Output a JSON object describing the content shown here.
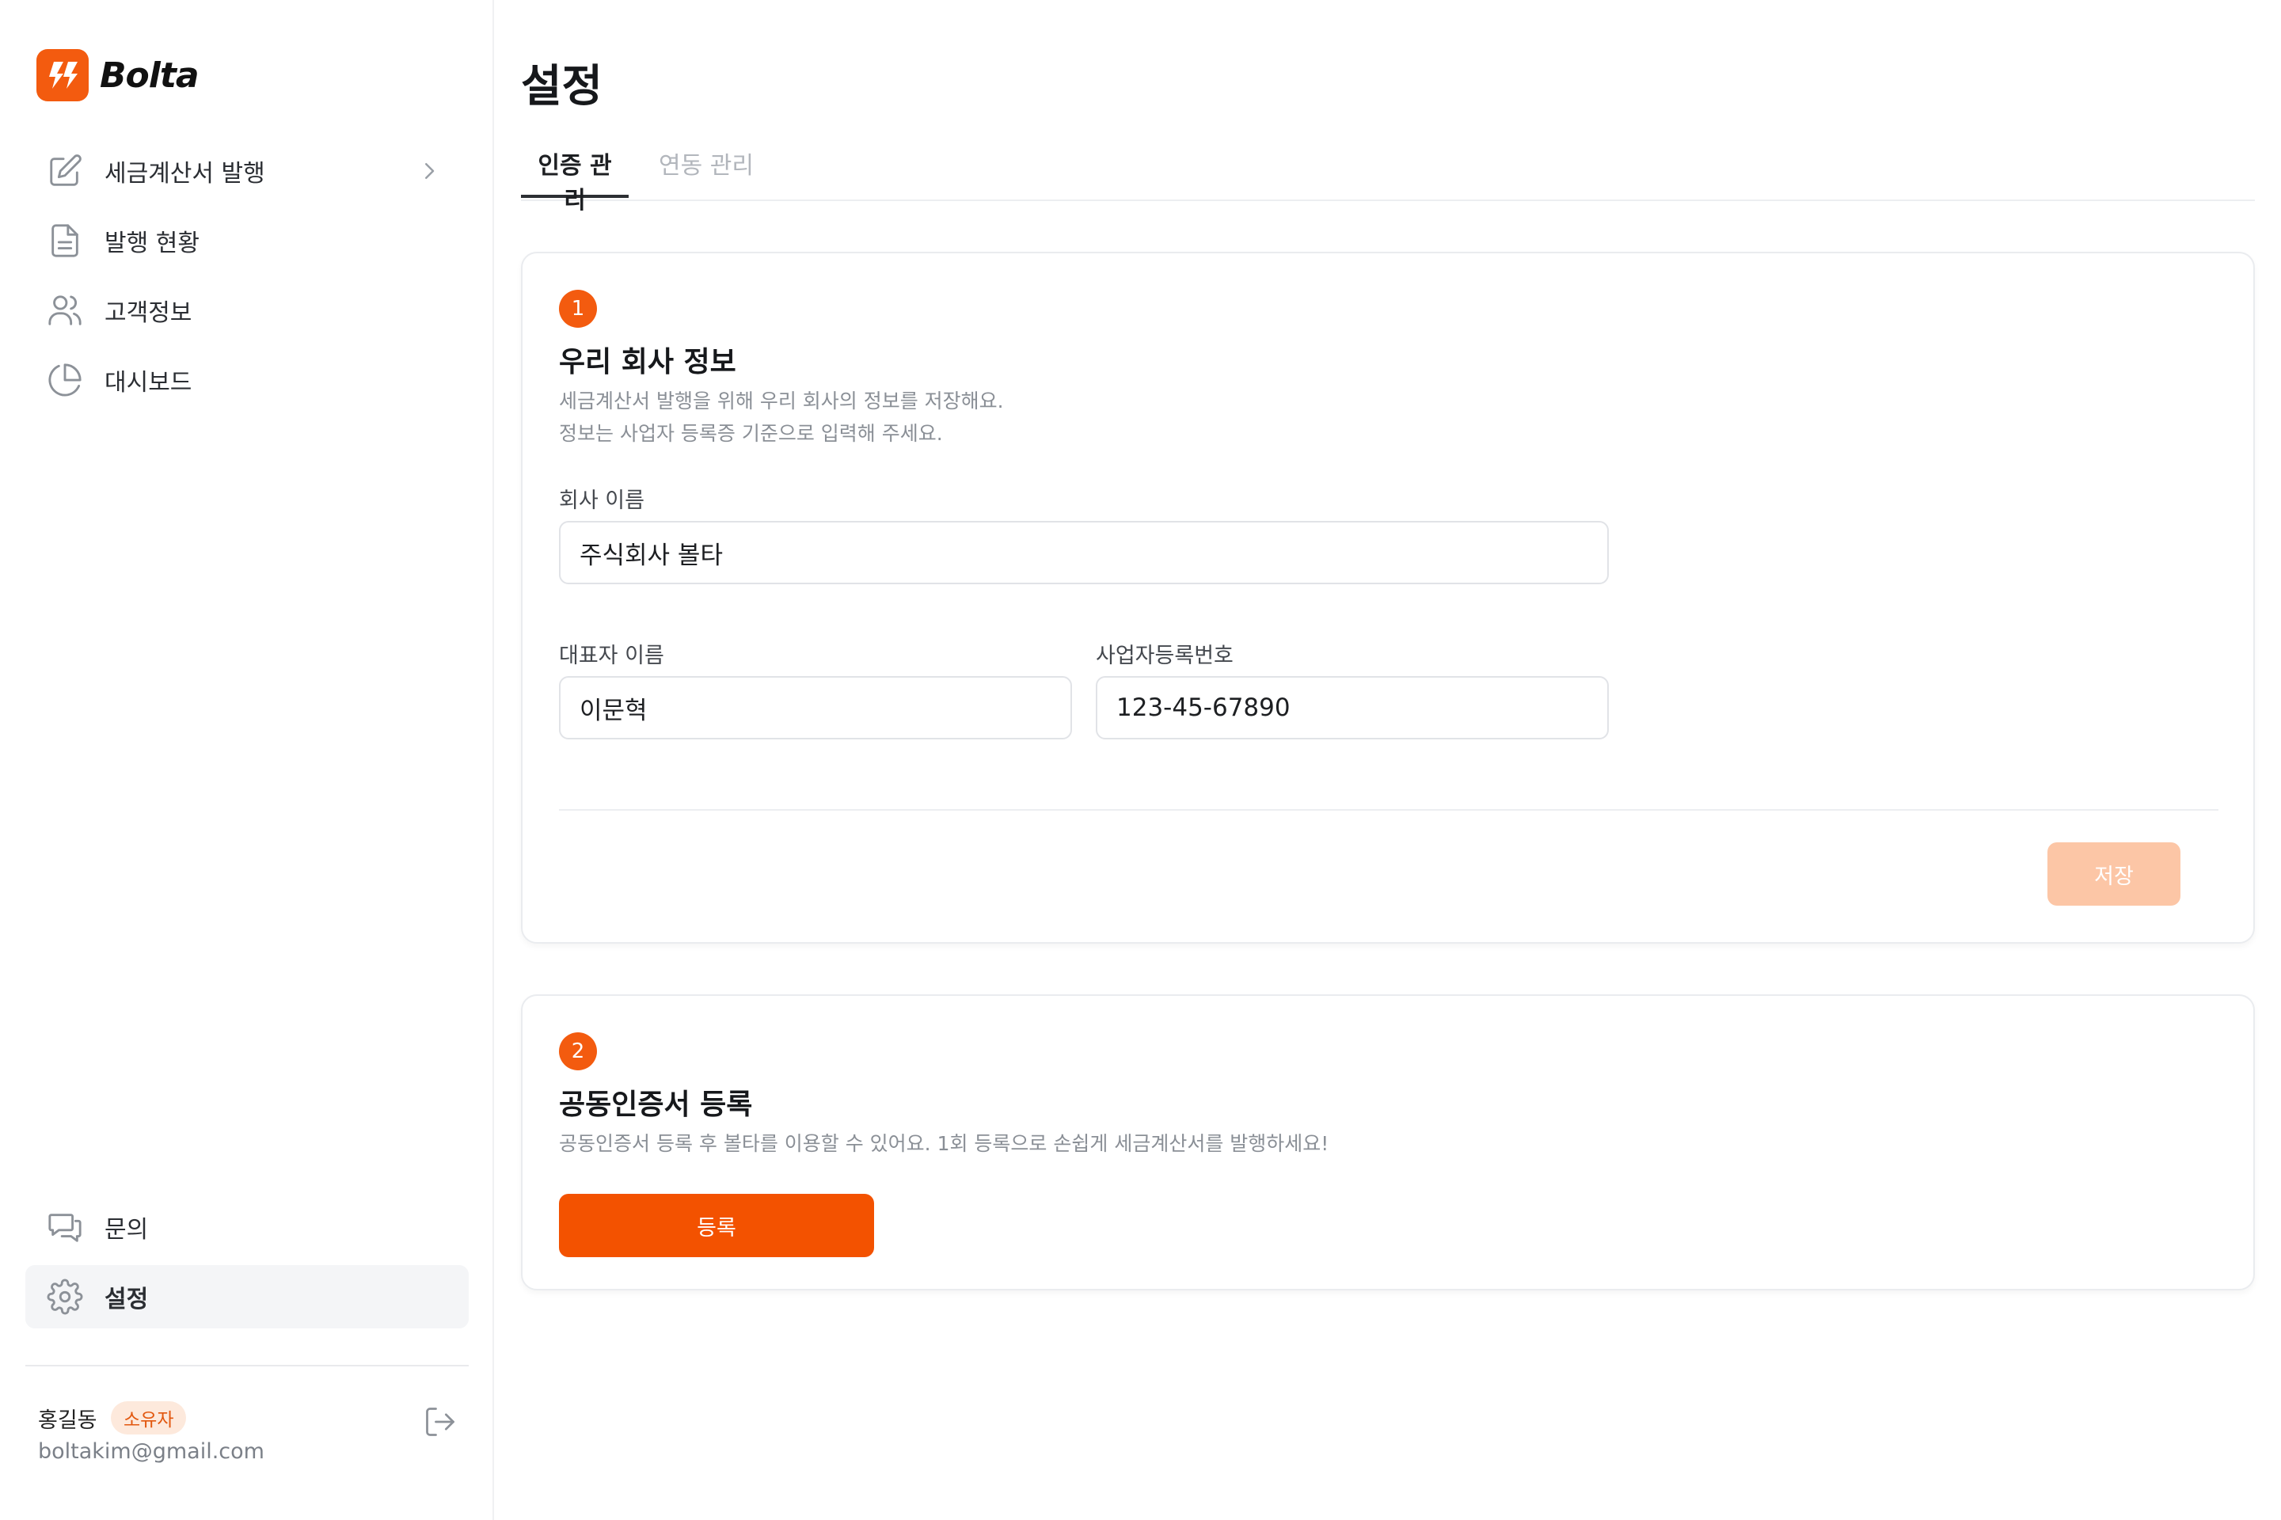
{
  "brand": {
    "name": "Bolta"
  },
  "sidebar": {
    "items": [
      {
        "label": "세금계산서 발행",
        "icon": "edit-icon"
      },
      {
        "label": "발행 현황",
        "icon": "document-icon"
      },
      {
        "label": "고객정보",
        "icon": "users-icon"
      },
      {
        "label": "대시보드",
        "icon": "pie-chart-icon"
      }
    ],
    "bottom_items": [
      {
        "label": "문의",
        "icon": "chat-icon"
      },
      {
        "label": "설정",
        "icon": "gear-icon",
        "active": true
      }
    ],
    "user": {
      "name": "홍길동",
      "role": "소유자",
      "email": "boltakim@gmail.com"
    }
  },
  "page": {
    "title": "설정"
  },
  "tabs": [
    {
      "label": "인증 관리",
      "active": true
    },
    {
      "label": "연동 관리",
      "active": false
    }
  ],
  "company_card": {
    "step": "1",
    "title": "우리 회사 정보",
    "desc_line1": "세금계산서 발행을 위해 우리 회사의 정보를 저장해요.",
    "desc_line2": "정보는 사업자 등록증 기준으로 입력해 주세요.",
    "company_name": {
      "label": "회사 이름",
      "value": "주식회사 볼타"
    },
    "ceo_name": {
      "label": "대표자 이름",
      "value": "이문혁"
    },
    "business_number": {
      "label": "사업자등록번호",
      "value": "123-45-67890"
    },
    "save_label": "저장"
  },
  "cert_card": {
    "step": "2",
    "title": "공동인증서 등록",
    "desc": "공동인증서 등록 후 볼타를 이용할 수 있어요. 1회 등록으로 손쉽게 세금계산서를 발행하세요!",
    "register_label": "등록"
  },
  "colors": {
    "accent": "#f35200",
    "accent_disabled": "#fcc6a6",
    "badge_bg": "#fde9dc",
    "active_nav_bg": "#f4f5f7"
  }
}
